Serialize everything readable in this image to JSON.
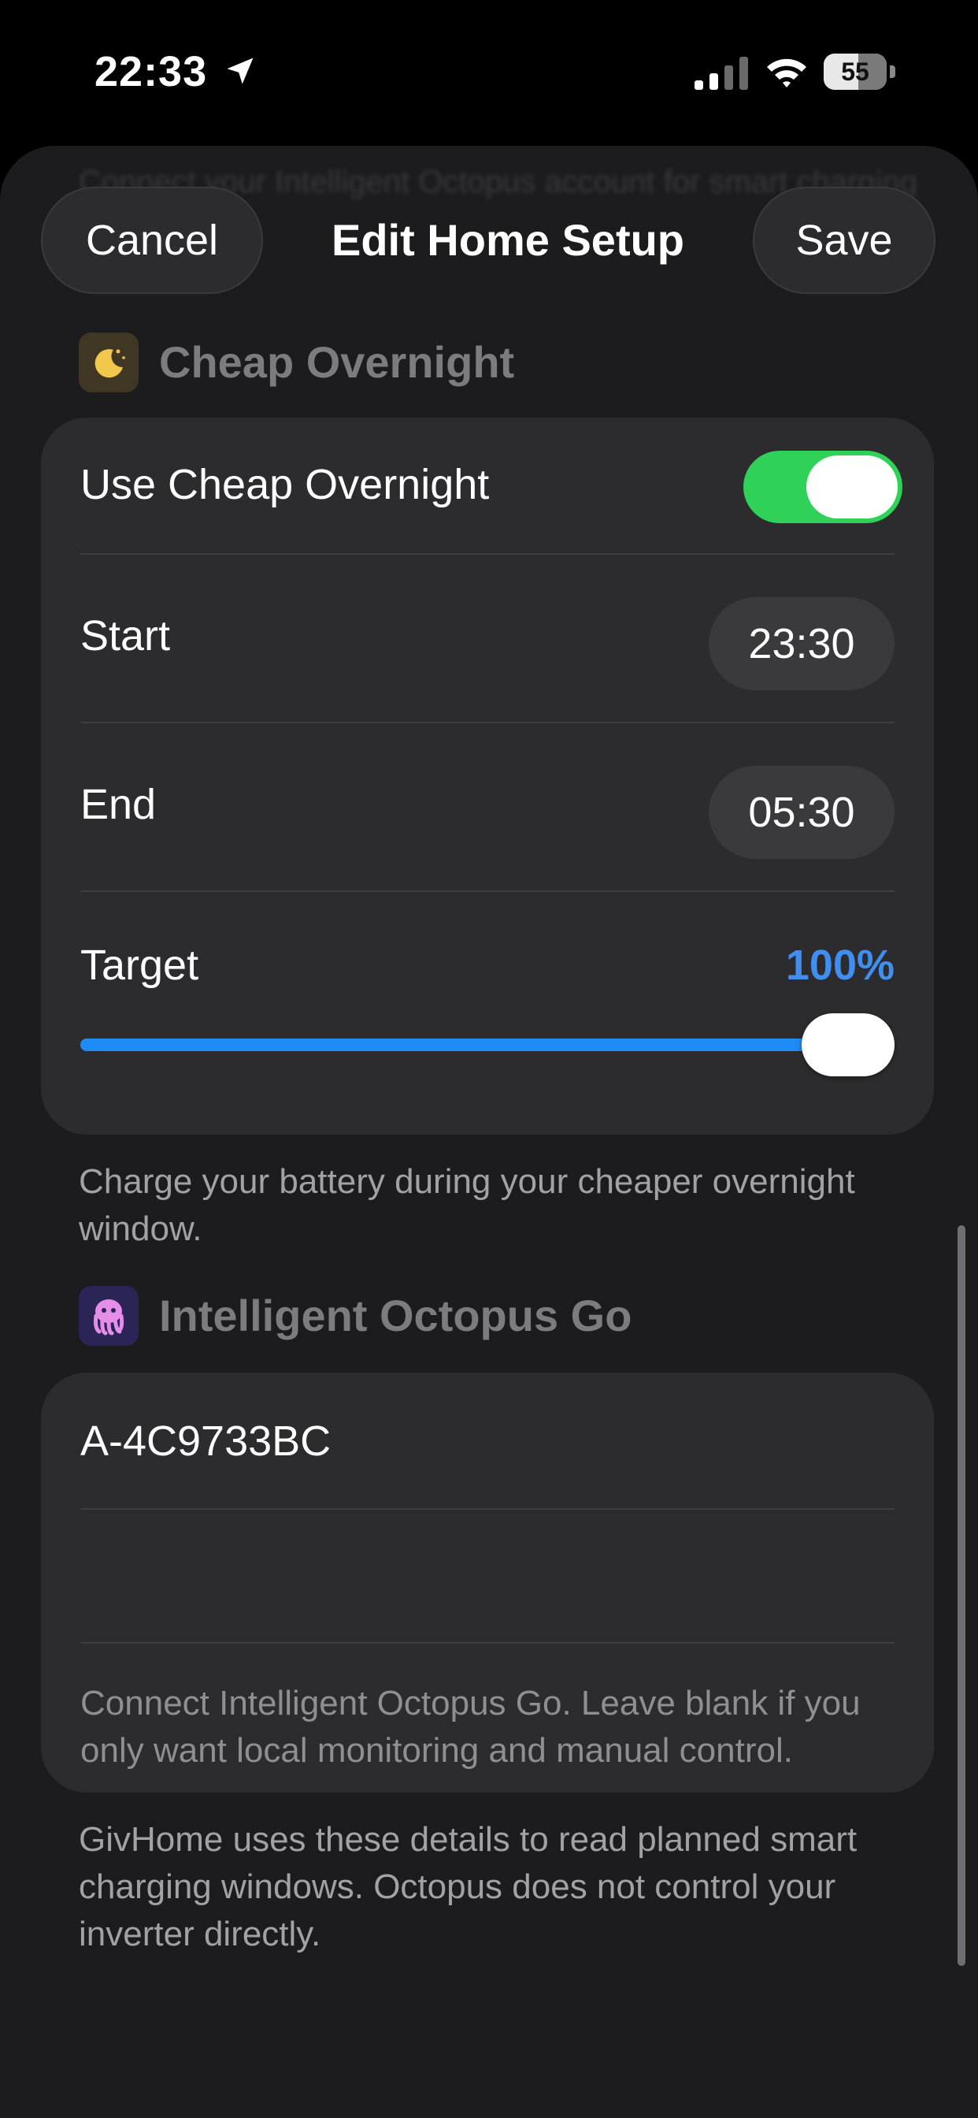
{
  "status_bar": {
    "time": "22:33",
    "battery_level": "55",
    "battery_fraction": 0.55
  },
  "header": {
    "background_text": "Connect your Intelligent Octopus account for smart charging windows",
    "cancel_label": "Cancel",
    "title": "Edit Home Setup",
    "save_label": "Save"
  },
  "cheap_overnight": {
    "section_title": "Cheap Overnight",
    "icon": "moon-icon",
    "toggle_label": "Use Cheap Overnight",
    "toggle_on": true,
    "start_label": "Start",
    "start_value": "23:30",
    "end_label": "End",
    "end_value": "05:30",
    "target_label": "Target",
    "target_value": "100%",
    "target_fraction": 1.0,
    "footnote": "Charge your battery during your cheaper overnight window."
  },
  "octopus": {
    "section_title": "Intelligent Octopus Go",
    "icon": "octopus-icon",
    "account_value": "A-4C9733BC",
    "second_field_value": "",
    "card_footnote": "Connect Intelligent Octopus Go. Leave blank if you only want local monitoring and manual control.",
    "footnote": "GivHome uses these details to read planned smart charging windows. Octopus does not control your inverter directly."
  },
  "colors": {
    "toggle_on": "#30d158",
    "accent_blue": "#3f8ef0",
    "slider_fill": "#1f8bf5",
    "card_bg": "#2c2c2e",
    "sheet_bg": "#1c1c1e"
  }
}
